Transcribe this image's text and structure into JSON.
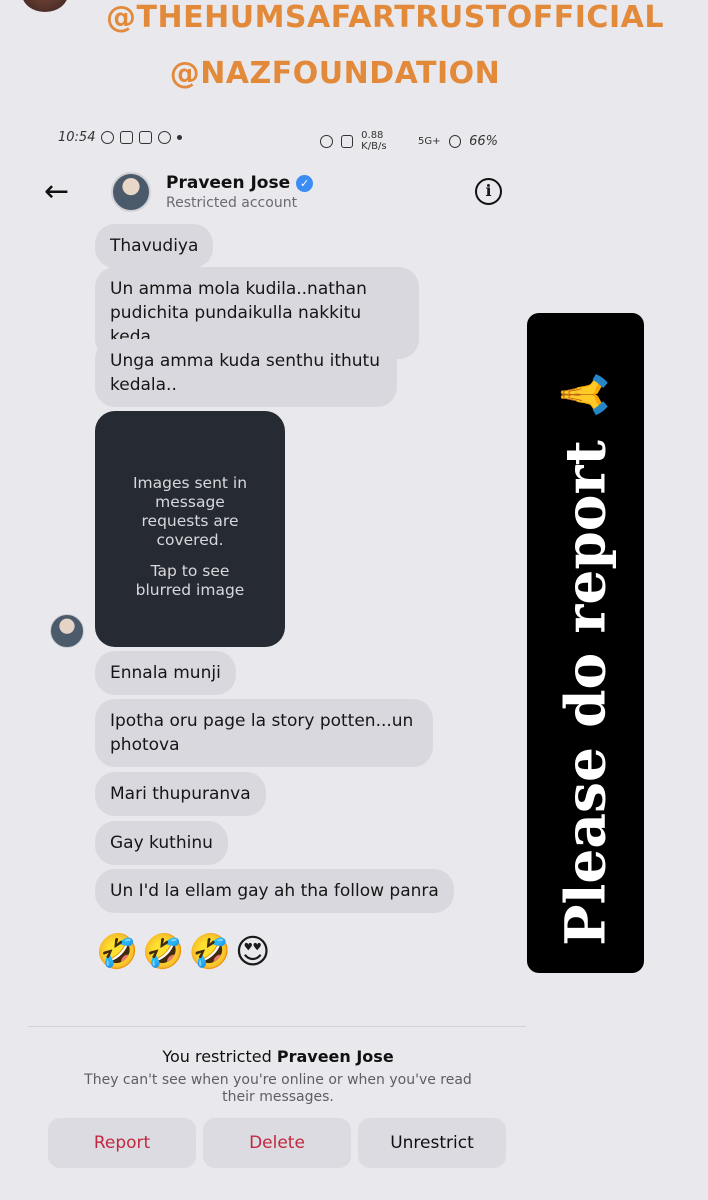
{
  "overlay": {
    "handle_1": "@THEHUMSAFARTRUSTOFFICIAL",
    "handle_2": "@NAZFOUNDATION",
    "report_banner_text": "Please do report",
    "report_banner_icon": "folded-hands-icon"
  },
  "status_bar": {
    "time": "10:54",
    "speed": "0.88 K/B/s",
    "network": "5G+",
    "battery": "66%"
  },
  "header": {
    "name": "Praveen Jose",
    "subtitle": "Restricted account"
  },
  "messages": [
    "Thavudiya",
    "Un amma mola kudila..nathan pudichita pundaikulla nakkitu keda",
    "Unga amma kuda senthu ithutu kedala..",
    "Ennala munji",
    "Ipotha oru page la story potten...un photova",
    "Mari thupuranva",
    "Gay kuthinu",
    "Un I'd la ellam gay ah tha follow panra"
  ],
  "blurred_image": {
    "line1": "Images sent in message requests are covered.",
    "line2": "Tap to see blurred image"
  },
  "emojis": [
    "🤣",
    "🤣",
    "🤣",
    "😍"
  ],
  "restrict_notice": {
    "prefix": "You restricted ",
    "name": "Praveen Jose",
    "description": "They can't see when you're online or when you've read their messages."
  },
  "actions": {
    "report": "Report",
    "delete": "Delete",
    "unrestrict": "Unrestrict"
  },
  "colors": {
    "handle_orange": "#e2893a",
    "danger_red": "#c0283f",
    "verified_blue": "#3a8df5"
  }
}
